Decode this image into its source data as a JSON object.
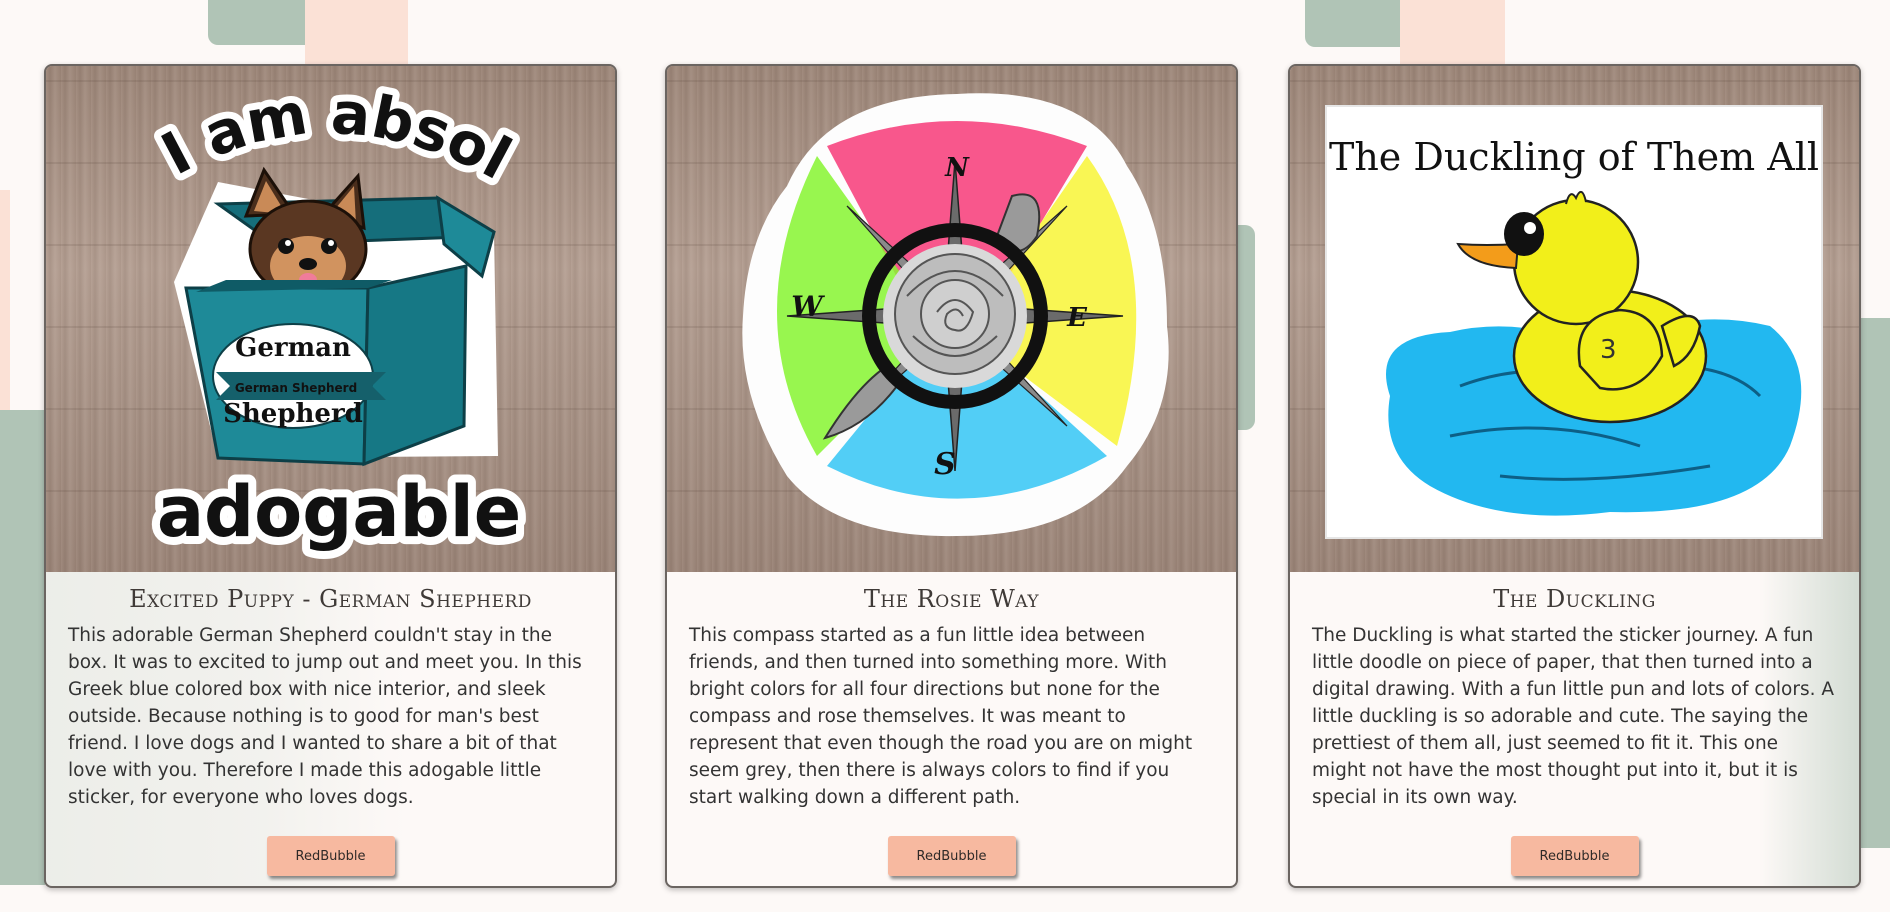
{
  "cards": [
    {
      "title": "Excited Puppy - German Shepherd",
      "description": "This adorable German Shepherd couldn't stay in the box. It was to excited to jump out and meet you. In this Greek blue colored box with nice interior, and sleek outside. Because nothing is to good for man's best friend. I love dogs and I wanted to share a bit of that love with you. Therefore I made this adogable little sticker, for everyone who loves dogs.",
      "button_label": "RedBubble",
      "sticker": {
        "top_text": "I am absolutely",
        "bottom_text": "adogable",
        "box_text_1": "German",
        "box_text_2": "German Shepherd",
        "box_text_3": "Shepherd",
        "box_color": "#1e8a98"
      }
    },
    {
      "title": "The Rosie Way",
      "description": "This compass started as a fun little idea between friends, and then turned into something more. With bright colors for all four directions but none for the compass and rose themselves. It was meant to represent that even though the road you are on might seem grey, then there is always colors to find if you start walking down a different path.",
      "button_label": "RedBubble",
      "sticker": {
        "north": "N",
        "east": "E",
        "south": "S",
        "west": "W",
        "colors": [
          "#f73a78",
          "#f8f436",
          "#34c6f4",
          "#86f530"
        ]
      }
    },
    {
      "title": "The Duckling",
      "description": "The Duckling is what started the sticker journey. A fun little doodle on piece of paper, that then turned into a digital drawing. With a fun little pun and lots of colors. A little duckling is so adorable and cute. The saying the prettiest of them all, just seemed to fit it. This one might not have the most thought put into it, but it is special in its own way.",
      "button_label": "RedBubble",
      "sticker": {
        "caption": "The Duckling of Them All",
        "wing_number": "3",
        "duck_color": "#f2ef1a",
        "water_color": "#22b8f0"
      }
    }
  ],
  "colors": {
    "accent_sage": "#b0c4b6",
    "accent_peach": "#fbe1d6",
    "button": "#f7b9a0"
  }
}
